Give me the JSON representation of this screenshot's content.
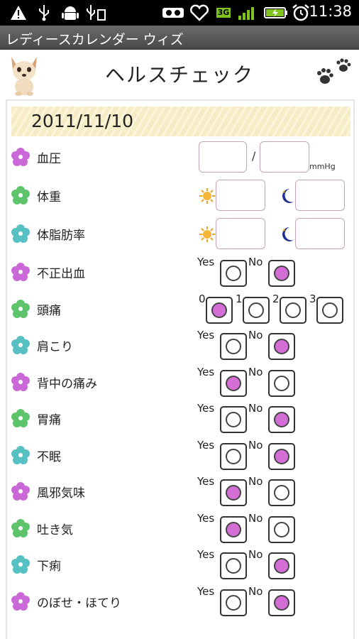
{
  "status_bar": {
    "icons": [
      "warning-icon",
      "usb-icon",
      "android-icon",
      "usb-debug-icon",
      "voicemail-icon",
      "heart-icon",
      "3g-icon",
      "signal-icon",
      "battery-icon",
      "alarm-icon"
    ],
    "network": "3G",
    "time": "11:38"
  },
  "app": {
    "title": "レディースカレンダー ウィズ"
  },
  "header": {
    "title": "ヘルスチェック"
  },
  "date": "2011/11/10",
  "colors": {
    "flower_purple": "#c968d6",
    "flower_green": "#5ec46c",
    "flower_teal": "#56c0c2",
    "radio_on": "#d46ed6",
    "input_border": "#c6a3b6"
  },
  "blood_pressure": {
    "label": "血圧",
    "separator": "/",
    "unit": "mmHg",
    "systolic": "",
    "diastolic": ""
  },
  "weight": {
    "label": "体重",
    "morning": "",
    "night": ""
  },
  "body_fat": {
    "label": "体脂肪率",
    "morning": "",
    "night": ""
  },
  "options": {
    "yes": "Yes",
    "no": "No"
  },
  "headache": {
    "label": "頭痛",
    "levels": [
      "0",
      "1",
      "2",
      "3"
    ],
    "selected": "0"
  },
  "yes_no_items": [
    {
      "label": "不正出血",
      "value": "No"
    },
    {
      "label": "肩こり",
      "value": "No"
    },
    {
      "label": "背中の痛み",
      "value": "Yes"
    },
    {
      "label": "胃痛",
      "value": "No"
    },
    {
      "label": "不眠",
      "value": "No"
    },
    {
      "label": "風邪気味",
      "value": "Yes"
    },
    {
      "label": "吐き気",
      "value": "Yes"
    },
    {
      "label": "下痢",
      "value": "No"
    },
    {
      "label": "のぼせ・ほてり",
      "value": "No"
    }
  ]
}
